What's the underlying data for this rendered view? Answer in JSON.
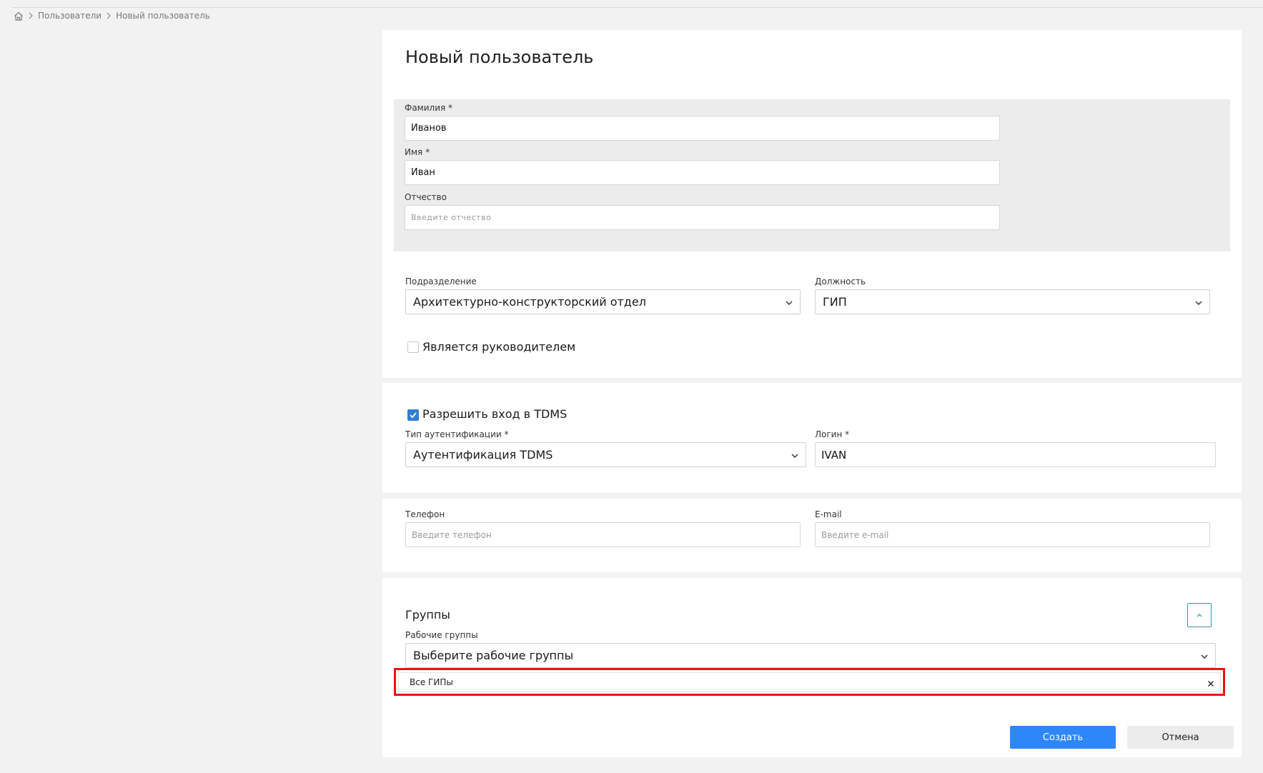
{
  "breadcrumb": {
    "home_icon": "home-icon",
    "items": [
      "Пользователи",
      "Новый пользователь"
    ]
  },
  "form": {
    "title": "Новый пользователь",
    "last_name": {
      "label": "Фамилия *",
      "value": "Иванов"
    },
    "first_name": {
      "label": "Имя *",
      "value": "Иван"
    },
    "middle_name": {
      "label": "Отчество",
      "placeholder": "Введите отчество"
    },
    "department": {
      "label": "Подразделение",
      "value": "Архитектурно-конструкторский отдел"
    },
    "position": {
      "label": "Должность",
      "value": "ГИП"
    },
    "is_manager": {
      "label": "Является руководителем",
      "checked": false
    }
  },
  "access": {
    "allow_login": {
      "label": "Разрешить вход в TDMS",
      "checked": true
    },
    "auth_type": {
      "label": "Тип аутентификации *",
      "value": "Аутентификация TDMS"
    },
    "login": {
      "label": "Логин *",
      "value": "IVAN"
    }
  },
  "contacts": {
    "phone": {
      "label": "Телефон",
      "placeholder": "Введите телефон"
    },
    "email": {
      "label": "E-mail",
      "placeholder": "Введите e-mail"
    }
  },
  "groups": {
    "title": "Группы",
    "work_groups": {
      "label": "Рабочие группы",
      "placeholder": "Выберите рабочие группы"
    },
    "selected": [
      "Все ГИПы"
    ]
  },
  "actions": {
    "create": "Создать",
    "cancel": "Отмена"
  },
  "colors": {
    "primary": "#2f86f6",
    "highlight": "#ee1111",
    "checkbox": "#2f7fd3",
    "collapse_border": "#2b9aa6"
  }
}
